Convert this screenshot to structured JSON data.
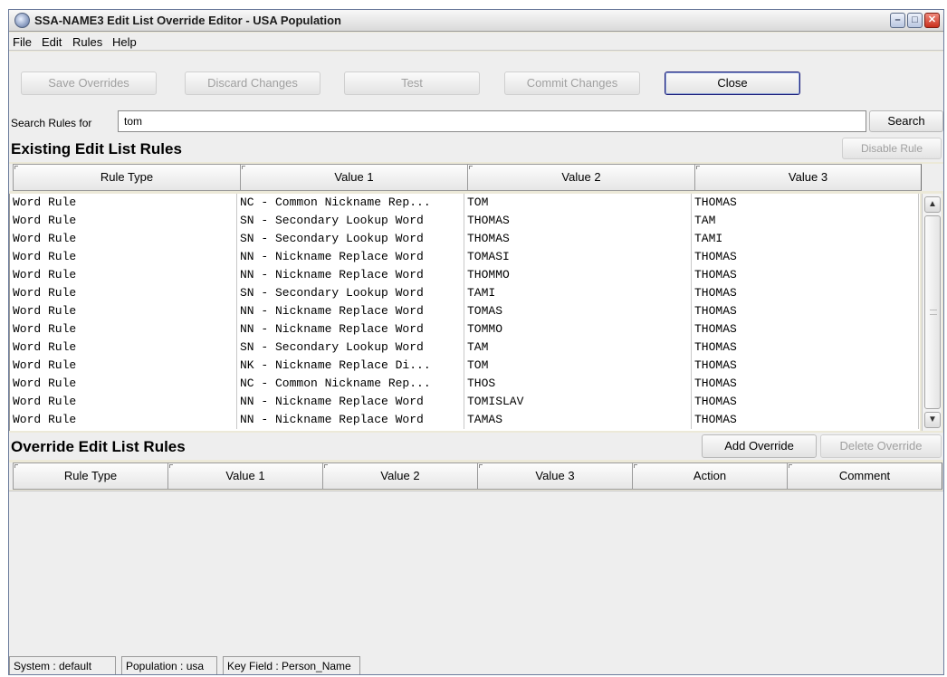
{
  "window": {
    "title": "SSA-NAME3 Edit List Override Editor - USA Population",
    "buttons": {
      "minimize": "–",
      "maximize": "□",
      "close": "✕"
    }
  },
  "menu": [
    "File",
    "Edit",
    "Rules",
    "Help"
  ],
  "toolbar": {
    "save_overrides": "Save Overrides",
    "discard_changes": "Discard Changes",
    "test": "Test",
    "commit_changes": "Commit Changes",
    "close": "Close"
  },
  "search": {
    "label": "Search Rules for",
    "value": "tom",
    "button": "Search"
  },
  "existing": {
    "title": "Existing Edit List Rules",
    "disable_button": "Disable Rule",
    "columns": [
      "Rule Type",
      "Value 1",
      "Value 2",
      "Value 3"
    ],
    "rows": [
      [
        "Word Rule",
        "NC - Common Nickname Rep...",
        "TOM",
        "THOMAS"
      ],
      [
        "Word Rule",
        "SN - Secondary Lookup Word",
        "THOMAS",
        "TAM"
      ],
      [
        "Word Rule",
        "SN - Secondary Lookup Word",
        "THOMAS",
        "TAMI"
      ],
      [
        "Word Rule",
        "NN - Nickname Replace Word",
        "TOMASI",
        "THOMAS"
      ],
      [
        "Word Rule",
        "NN - Nickname Replace Word",
        "THOMMO",
        "THOMAS"
      ],
      [
        "Word Rule",
        "SN - Secondary Lookup Word",
        "TAMI",
        "THOMAS"
      ],
      [
        "Word Rule",
        "NN - Nickname Replace Word",
        "TOMAS",
        "THOMAS"
      ],
      [
        "Word Rule",
        "NN - Nickname Replace Word",
        "TOMMO",
        "THOMAS"
      ],
      [
        "Word Rule",
        "SN - Secondary Lookup Word",
        "TAM",
        "THOMAS"
      ],
      [
        "Word Rule",
        "NK - Nickname Replace Di...",
        "TOM",
        "THOMAS"
      ],
      [
        "Word Rule",
        "NC - Common Nickname Rep...",
        "THOS",
        "THOMAS"
      ],
      [
        "Word Rule",
        "NN - Nickname Replace Word",
        "TOMISLAV",
        "THOMAS"
      ],
      [
        "Word Rule",
        "NN - Nickname Replace Word",
        "TAMAS",
        "THOMAS"
      ]
    ]
  },
  "override": {
    "title": "Override Edit List Rules",
    "add_button": "Add Override",
    "delete_button": "Delete Override",
    "columns": [
      "Rule Type",
      "Value 1",
      "Value 2",
      "Value 3",
      "Action",
      "Comment"
    ]
  },
  "status": {
    "system": "System : default",
    "population": "Population : usa",
    "key_field": "Key Field : Person_Name"
  },
  "icons": {
    "app": "gear-icon",
    "scroll_up": "▲",
    "scroll_down": "▼"
  }
}
